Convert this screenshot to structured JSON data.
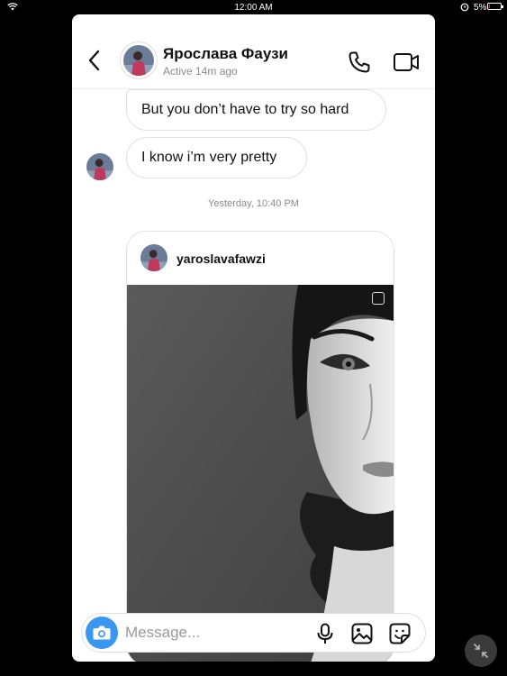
{
  "status_bar": {
    "time": "12:00 AM",
    "battery_percent": "5%",
    "battery_level": 0.05
  },
  "header": {
    "contact_name": "Ярослава Фаузи",
    "contact_status": "Active 14m ago",
    "icons": {
      "back": "chevron-left-icon",
      "call": "phone-icon",
      "video": "video-camera-icon"
    }
  },
  "messages": [
    {
      "text": "But you don’t have to try so hard"
    },
    {
      "text": "I know i’m very pretty"
    }
  ],
  "timestamp": "Yesterday, 10:40 PM",
  "shared_post": {
    "username": "yaroslavafawzi"
  },
  "composer": {
    "placeholder": "Message...",
    "icons": {
      "camera": "camera-icon",
      "mic": "microphone-icon",
      "gallery": "image-icon",
      "sticker": "sticker-icon"
    }
  },
  "colors": {
    "accent": "#3897f0",
    "battery_low": "#e33333"
  }
}
